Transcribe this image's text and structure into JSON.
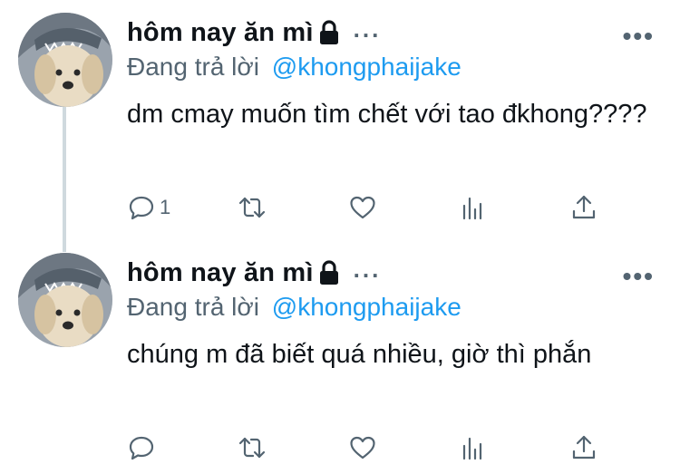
{
  "tweets": [
    {
      "author_name": "hôm nay ăn mì",
      "name_ellipsis": "...",
      "more_label": "•••",
      "reply_prefix": "Đang trả lời",
      "reply_handle": "@khongphaijake",
      "text": "dm cmay muốn tìm chết với tao đkhong????",
      "reply_count": "1",
      "icons": [
        "reply-icon",
        "retweet-icon",
        "like-icon",
        "stats-icon",
        "share-icon"
      ]
    },
    {
      "author_name": "hôm nay ăn mì",
      "name_ellipsis": "...",
      "more_label": "•••",
      "reply_prefix": "Đang trả lời",
      "reply_handle": "@khongphaijake",
      "text": "chúng m đã biết quá nhiều, giờ thì phắn",
      "reply_count": "",
      "icons": [
        "reply-icon",
        "retweet-icon",
        "like-icon",
        "stats-icon",
        "share-icon"
      ]
    }
  ],
  "colors": {
    "link": "#1d9bf0",
    "secondary_text": "#536471",
    "thread_line": "#cfd9de"
  }
}
